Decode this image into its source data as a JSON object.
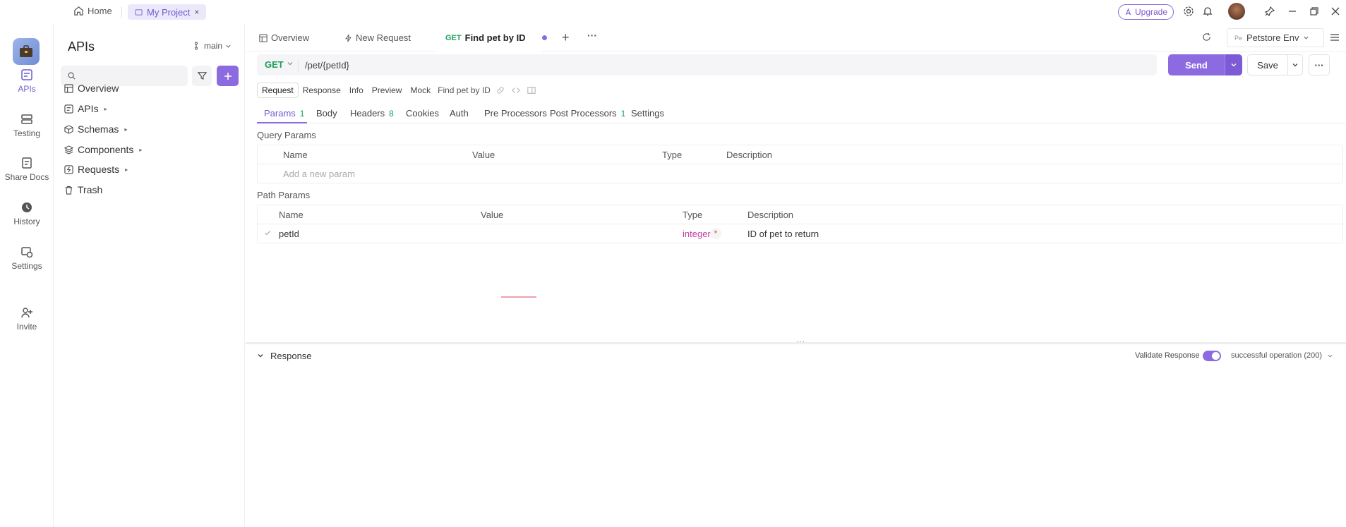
{
  "titlebar": {
    "home": "Home",
    "project_tab": "My Project",
    "project_close": "×",
    "upgrade": "Upgrade"
  },
  "leftnav": {
    "items": [
      {
        "label": "APIs",
        "icon": "apis-icon",
        "active": true
      },
      {
        "label": "Testing",
        "icon": "testing-icon"
      },
      {
        "label": "Share Docs",
        "icon": "share-docs-icon"
      },
      {
        "label": "History",
        "icon": "history-icon"
      },
      {
        "label": "Settings",
        "icon": "settings-icon"
      },
      {
        "label": "Invite",
        "icon": "invite-icon"
      }
    ]
  },
  "sidebar": {
    "title": "APIs",
    "branch": "main",
    "tree": [
      {
        "label": "Overview",
        "icon": "overview-icon"
      },
      {
        "label": "APIs",
        "icon": "apis-folder-icon",
        "expandable": true
      },
      {
        "label": "Schemas",
        "icon": "schemas-icon",
        "expandable": true
      },
      {
        "label": "Components",
        "icon": "components-icon",
        "expandable": true
      },
      {
        "label": "Requests",
        "icon": "requests-icon",
        "expandable": true
      },
      {
        "label": "Trash",
        "icon": "trash-icon"
      }
    ]
  },
  "tabs": {
    "overview": "Overview",
    "new_request": "New Request",
    "active_method": "GET",
    "active_title": "Find pet by ID",
    "add": "+",
    "more": "···"
  },
  "env": {
    "badge": "Pe",
    "name": "Petstore Env"
  },
  "request": {
    "method": "GET",
    "path": "/pet/{petId}",
    "send": "Send",
    "save": "Save",
    "more": "···"
  },
  "segments": {
    "items": [
      "Request",
      "Response",
      "Info",
      "Preview",
      "Mock"
    ],
    "active": "Request",
    "endpoint_name": "Find pet by ID"
  },
  "subtabs": {
    "params": {
      "label": "Params",
      "count": "1"
    },
    "body": {
      "label": "Body"
    },
    "headers": {
      "label": "Headers",
      "count": "8"
    },
    "cookies": {
      "label": "Cookies"
    },
    "auth": {
      "label": "Auth"
    },
    "pre": {
      "label": "Pre Processors"
    },
    "post": {
      "label": "Post Processors",
      "count": "1"
    },
    "settings": {
      "label": "Settings"
    }
  },
  "query_params": {
    "title": "Query Params",
    "columns": [
      "Name",
      "Value",
      "Type",
      "Description"
    ],
    "placeholder": "Add a new param"
  },
  "path_params": {
    "title": "Path Params",
    "columns": [
      "Name",
      "Value",
      "Type",
      "Description"
    ],
    "rows": [
      {
        "name": "petId",
        "value": "",
        "type": "integer",
        "required": "*",
        "description": "ID of pet to return"
      }
    ]
  },
  "response": {
    "title": "Response",
    "validate_label": "Validate Response",
    "validate_on": true,
    "status": "successful operation (200)"
  },
  "colors": {
    "accent": "#8c6be0",
    "get_method": "#1aa15b",
    "type_integer": "#c040a0"
  }
}
